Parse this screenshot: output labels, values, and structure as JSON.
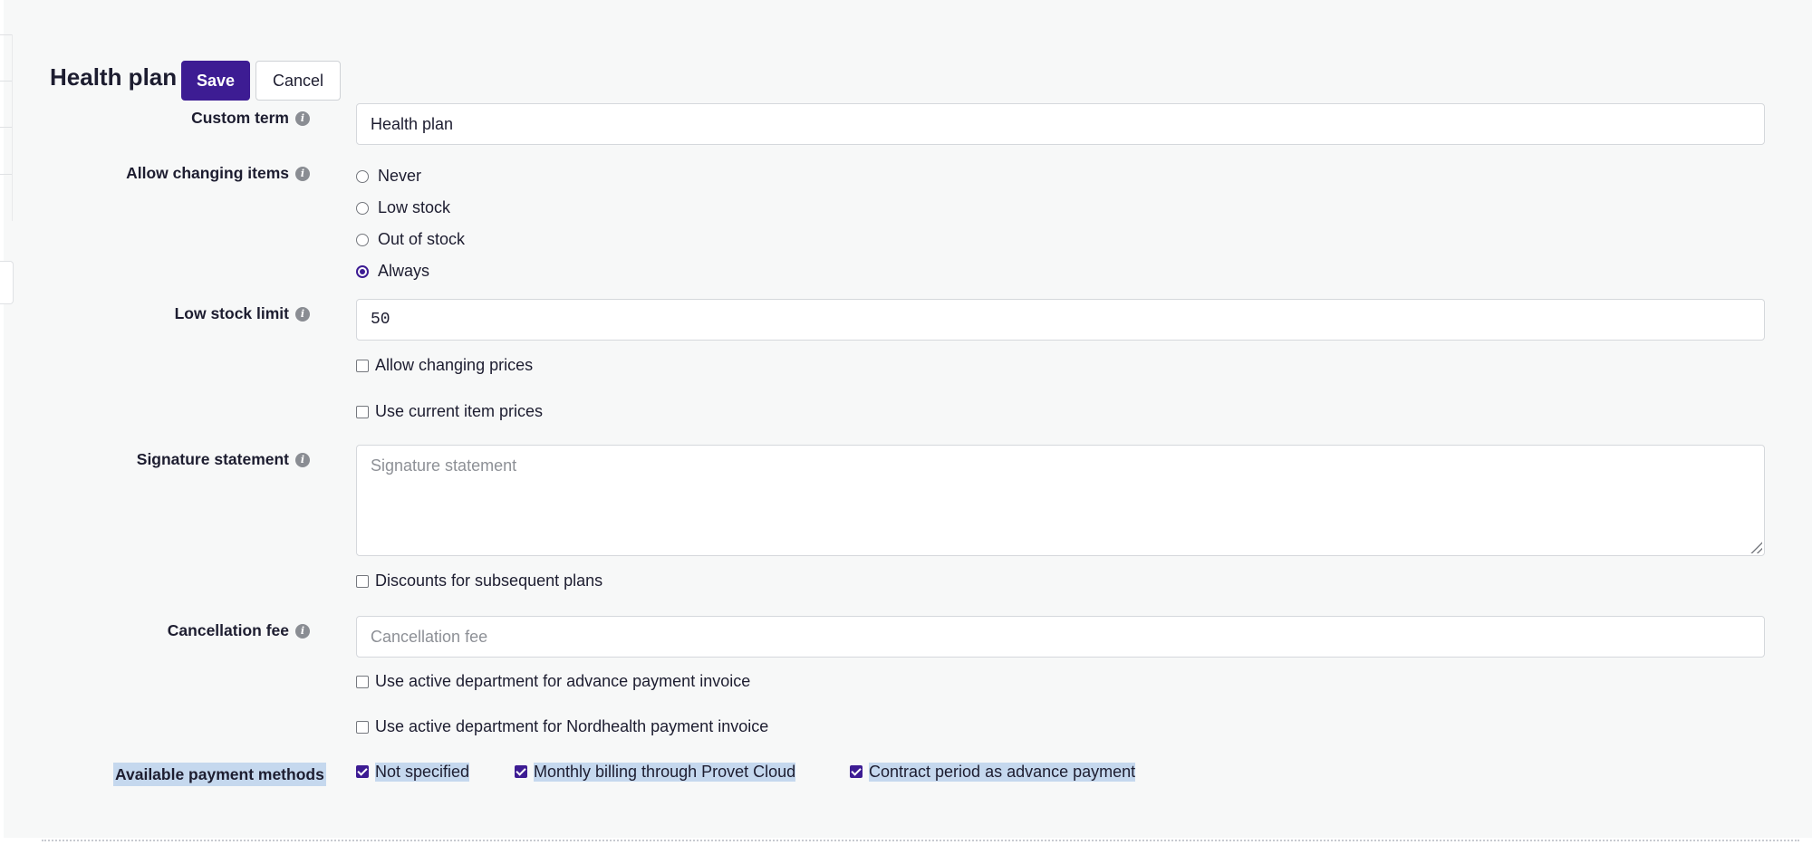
{
  "page": {
    "title": "Health plan",
    "save_label": "Save",
    "cancel_label": "Cancel"
  },
  "custom_term": {
    "label": "Custom term",
    "value": "Health plan"
  },
  "allow_changing_items": {
    "label": "Allow changing items",
    "options": [
      "Never",
      "Low stock",
      "Out of stock",
      "Always"
    ],
    "selected": "Always"
  },
  "low_stock_limit": {
    "label": "Low stock limit",
    "value": "50"
  },
  "checkboxes": {
    "allow_changing_prices": {
      "label": "Allow changing prices",
      "checked": false
    },
    "use_current_item_prices": {
      "label": "Use current item prices",
      "checked": false
    },
    "discounts_subsequent_plans": {
      "label": "Discounts for subsequent plans",
      "checked": false
    },
    "active_dept_advance_invoice": {
      "label": "Use active department for advance payment invoice",
      "checked": false
    },
    "active_dept_nordhealth_invoice": {
      "label": "Use active department for Nordhealth payment invoice",
      "checked": false
    }
  },
  "signature_statement": {
    "label": "Signature statement",
    "placeholder": "Signature statement"
  },
  "cancellation_fee": {
    "label": "Cancellation fee",
    "placeholder": "Cancellation fee"
  },
  "payment_methods": {
    "label": "Available payment methods",
    "options": [
      {
        "label": "Not specified",
        "checked": true
      },
      {
        "label": "Monthly billing through Provet Cloud",
        "checked": true
      },
      {
        "label": "Contract period as advance payment",
        "checked": true
      }
    ]
  },
  "colors": {
    "accent": "#3d1c93",
    "selection_highlight": "#c5d8ee",
    "background": "#f7f8f8"
  },
  "icons": {
    "info": "info-icon"
  }
}
